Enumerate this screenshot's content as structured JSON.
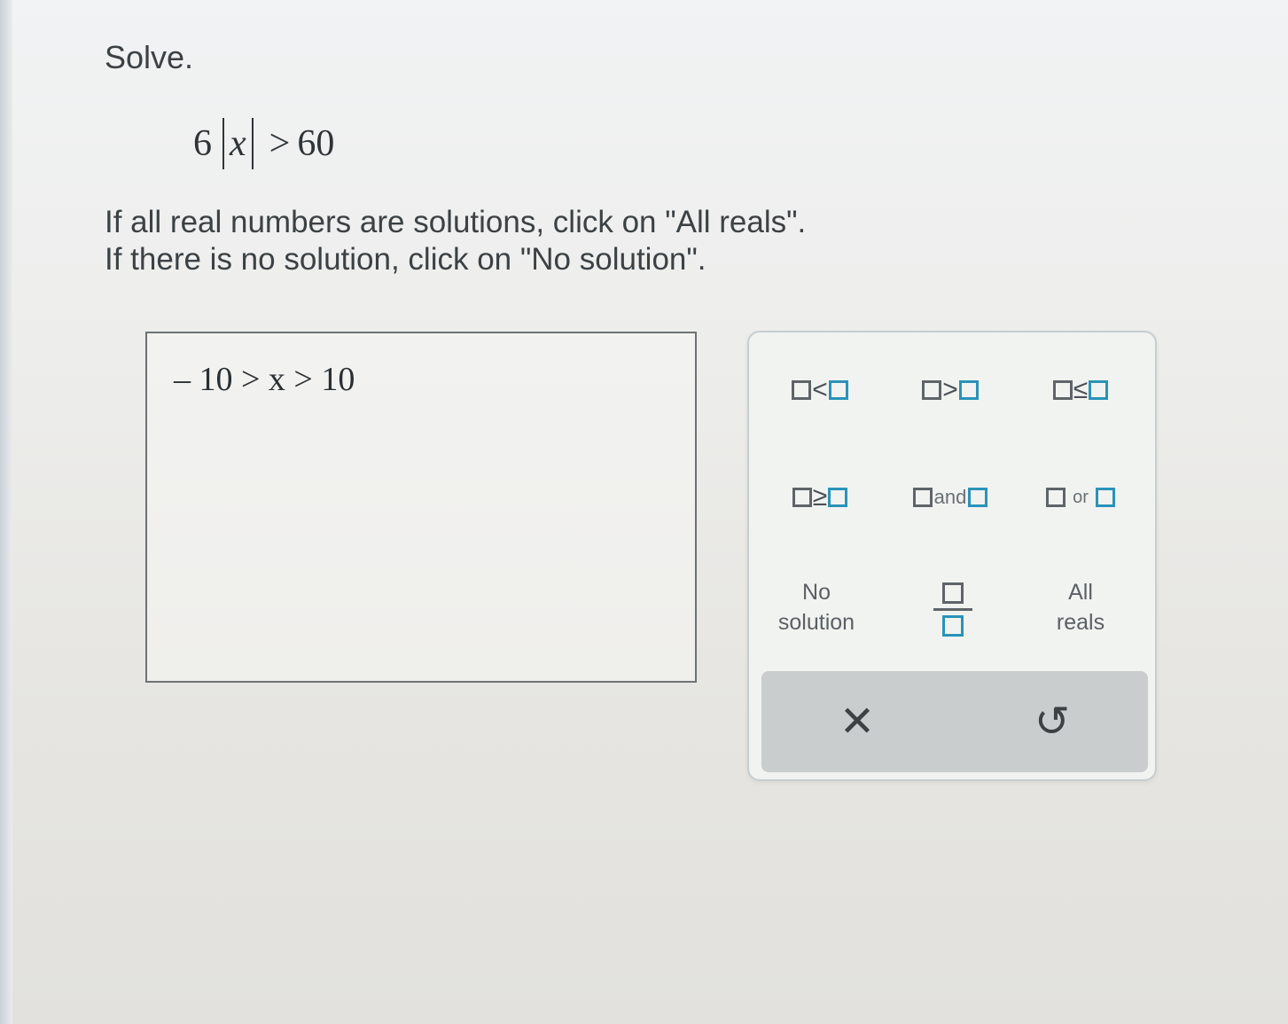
{
  "problem": {
    "prompt": "Solve.",
    "equation": {
      "coefficient": "6",
      "variable": "x",
      "operator": ">",
      "rhs": "60"
    },
    "instruction_line1": "If all real numbers are solutions, click on \"All reals\".",
    "instruction_line2": "If there is no solution, click on \"No solution\"."
  },
  "answer": {
    "value": "– 10 > x > 10"
  },
  "keypad": {
    "less_than": "<",
    "greater_than": ">",
    "less_equal": "≤",
    "greater_equal": "≥",
    "and_label": "and",
    "or_label": "or",
    "no_solution_line1": "No",
    "no_solution_line2": "solution",
    "all_reals_line1": "All",
    "all_reals_line2": "reals",
    "clear_symbol": "✕",
    "undo_symbol": "↺"
  },
  "colors": {
    "accent": "#2a93b8",
    "action_bar": "#c9cdcd",
    "text": "#3c4144"
  }
}
